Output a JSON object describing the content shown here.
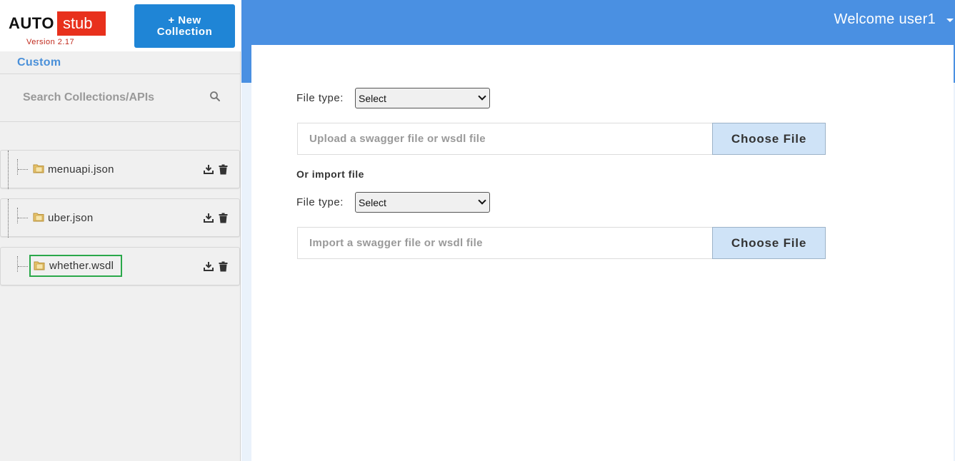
{
  "brand": {
    "logo_left": "AUTO",
    "logo_right": "stub",
    "version": "Version 2.17",
    "new_collection_label_line1": "+ New",
    "new_collection_label_line2": "Collection"
  },
  "sidebar": {
    "section_label": "Custom",
    "search_placeholder": "Search Collections/APIs",
    "items": [
      {
        "name": "menuapi.json",
        "selected": false
      },
      {
        "name": "uber.json",
        "selected": false
      },
      {
        "name": "whether.wsdl",
        "selected": true
      }
    ]
  },
  "header": {
    "welcome": "Welcome user1"
  },
  "form": {
    "upload": {
      "file_type_label": "File type:",
      "select_value": "Select",
      "placeholder": "Upload a swagger file or wsdl file",
      "choose_label": "Choose File"
    },
    "or_import_label": "Or import file",
    "import": {
      "file_type_label": "File type:",
      "select_value": "Select",
      "placeholder": "Import a swagger file or wsdl file",
      "choose_label": "Choose File"
    }
  },
  "colors": {
    "header_blue": "#4a90e2",
    "button_blue": "#1f85d6",
    "logo_red": "#e8301c",
    "selected_outline": "#2aa84a",
    "choose_button_bg": "#cfe3f7"
  }
}
